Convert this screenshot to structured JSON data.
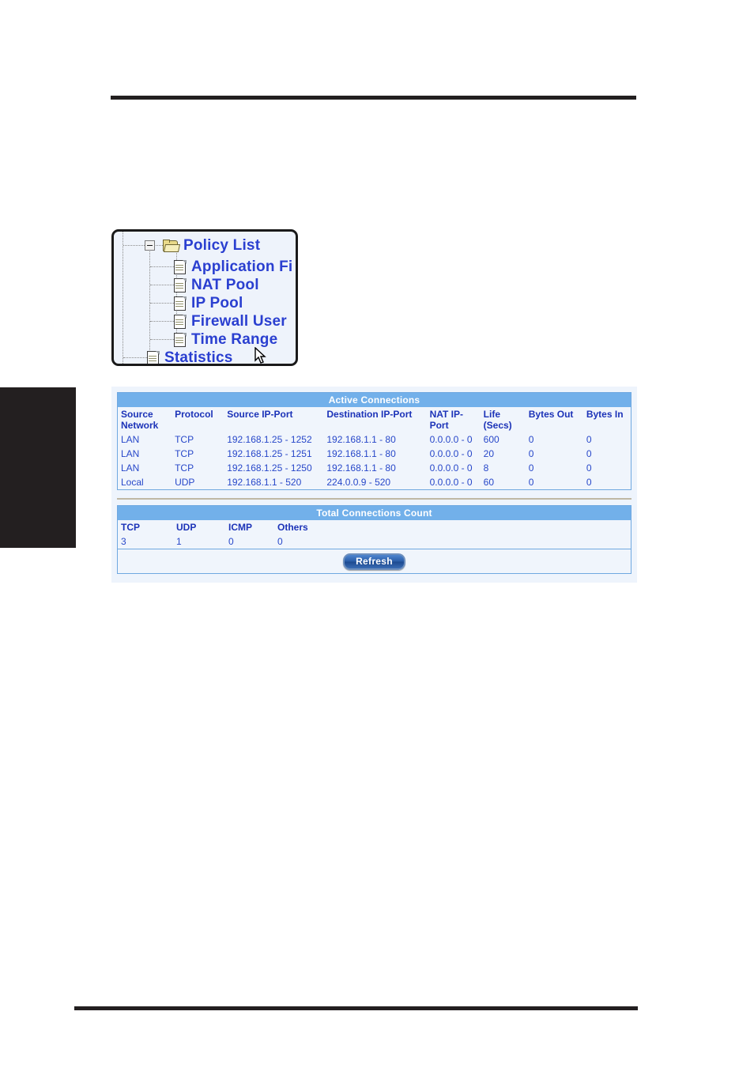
{
  "tree": {
    "items": [
      {
        "label": "Policy List",
        "icon": "folder-open-icon",
        "level": 0,
        "expander": "minus"
      },
      {
        "label": "Application Fi",
        "icon": "document-icon",
        "level": 1,
        "expander": "none"
      },
      {
        "label": "NAT Pool",
        "icon": "document-icon",
        "level": 1,
        "expander": "none"
      },
      {
        "label": "IP Pool",
        "icon": "document-icon",
        "level": 1,
        "expander": "none"
      },
      {
        "label": "Firewall User",
        "icon": "document-icon",
        "level": 1,
        "expander": "none"
      },
      {
        "label": "Time Range",
        "icon": "document-icon",
        "level": 1,
        "expander": "none"
      },
      {
        "label": "Statistics",
        "icon": "document-icon",
        "level": 0,
        "expander": "none"
      }
    ],
    "cursor_icon": "mouse-pointer-icon"
  },
  "active_connections": {
    "title": "Active Connections",
    "columns": [
      "Source Network",
      "Protocol",
      "Source IP-Port",
      "Destination IP-Port",
      "NAT IP-Port",
      "Life (Secs)",
      "Bytes Out",
      "Bytes In"
    ],
    "columns_split": [
      [
        "Source",
        "Network"
      ],
      [
        "Protocol",
        ""
      ],
      [
        "Source IP-Port",
        ""
      ],
      [
        "Destination IP-Port",
        ""
      ],
      [
        "NAT IP-",
        "Port"
      ],
      [
        "Life",
        "(Secs)"
      ],
      [
        "Bytes Out",
        ""
      ],
      [
        "Bytes In",
        ""
      ]
    ],
    "rows": [
      [
        "LAN",
        "TCP",
        "192.168.1.25 - 1252",
        "192.168.1.1 - 80",
        "0.0.0.0 - 0",
        "600",
        "0",
        "0"
      ],
      [
        "LAN",
        "TCP",
        "192.168.1.25 - 1251",
        "192.168.1.1 - 80",
        "0.0.0.0 - 0",
        "20",
        "0",
        "0"
      ],
      [
        "LAN",
        "TCP",
        "192.168.1.25 - 1250",
        "192.168.1.1 - 80",
        "0.0.0.0 - 0",
        "8",
        "0",
        "0"
      ],
      [
        "Local",
        "UDP",
        "192.168.1.1 - 520",
        "224.0.0.9 - 520",
        "0.0.0.0 - 0",
        "60",
        "0",
        "0"
      ]
    ]
  },
  "total_connections": {
    "title": "Total Connections Count",
    "columns": [
      "TCP",
      "UDP",
      "ICMP",
      "Others"
    ],
    "rows": [
      [
        "3",
        "1",
        "0",
        "0"
      ]
    ],
    "refresh_label": "Refresh"
  },
  "colors": {
    "header_blue": "#72b0ea",
    "panel_bg": "#eef4fc",
    "table_bg": "#f0f5fc",
    "table_border": "#6fa8e0",
    "link_blue": "#2a3fd0",
    "rule_black": "#231f20",
    "divider": "#bfb8a4"
  }
}
